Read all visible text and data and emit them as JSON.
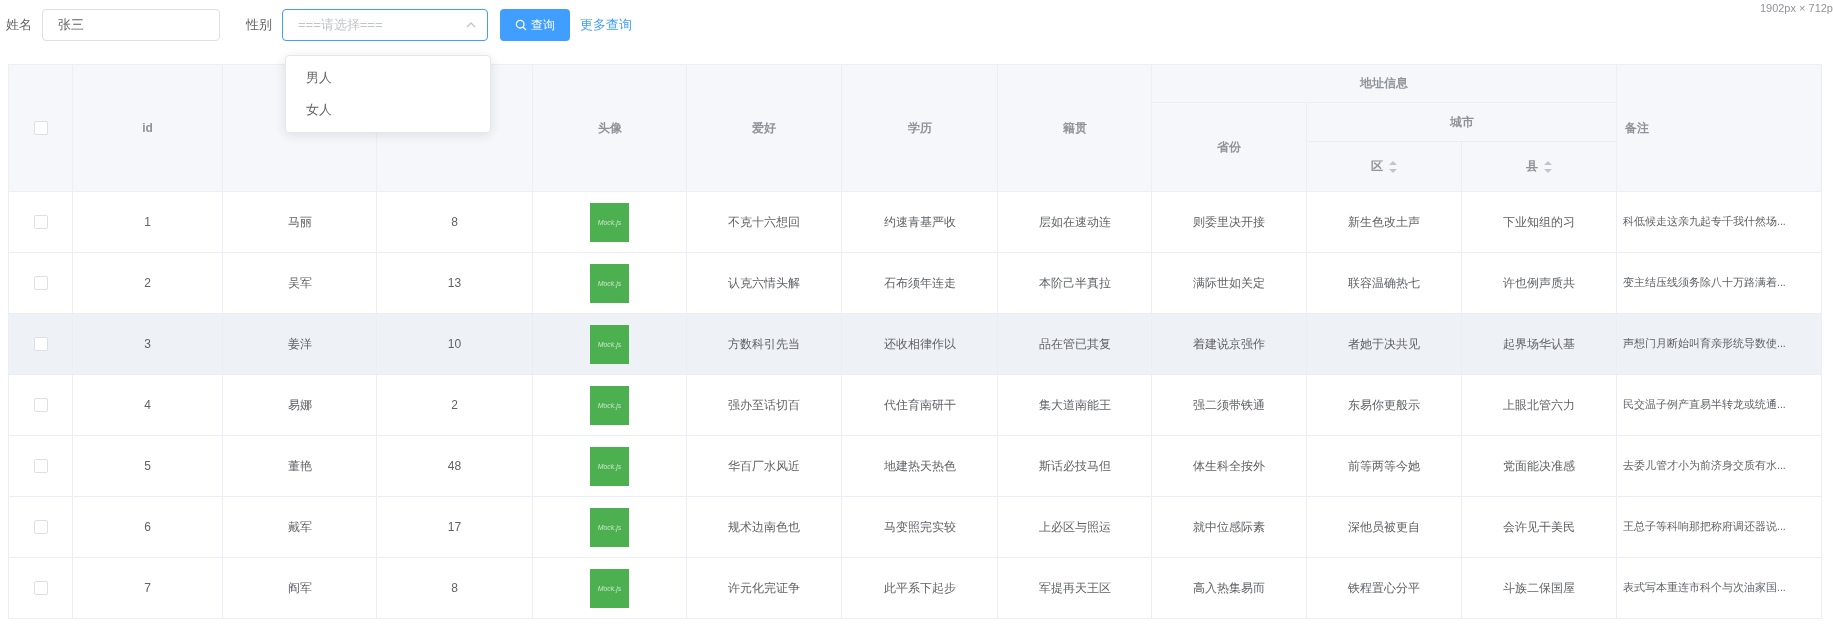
{
  "size_note": "1902px × 712p",
  "filters": {
    "name_label": "姓名",
    "name_value": "张三",
    "gender_label": "性别",
    "gender_placeholder": "===请选择===",
    "gender_expanded": true,
    "gender_options": [
      "男人",
      "女人"
    ],
    "query_button": "查询",
    "more_link": "更多查询"
  },
  "table": {
    "select_all_checked": false,
    "columns": [
      {
        "title": "id"
      },
      {},
      {},
      {
        "title": "头像"
      },
      {
        "title": "爱好"
      },
      {
        "title": "学历"
      },
      {
        "title": "籍贯"
      },
      {
        "title": "地址信息",
        "colspan": 3,
        "children": [
          {
            "title": "省份"
          },
          {
            "title": "城市",
            "colspan": 2,
            "children": [
              {
                "title": "区",
                "sortable": true
              },
              {
                "title": "县",
                "sortable": true
              }
            ]
          }
        ]
      },
      {
        "title": "备注"
      }
    ],
    "rows": [
      {
        "checked": false,
        "highlighted": false,
        "cells": [
          "1",
          "马丽",
          "8",
          "Mock.js",
          "不克十六想回",
          "约速青基严收",
          "层如在速动连",
          "则委里决开接",
          "新生色改土声",
          "下业知组的习",
          "科低候走这亲九起专千我什然场..."
        ]
      },
      {
        "checked": false,
        "highlighted": false,
        "cells": [
          "2",
          "吴军",
          "13",
          "Mock.js",
          "认克六情头解",
          "石布须年连走",
          "本阶己半真拉",
          "满际世如关定",
          "联容温确热七",
          "许也例声质共",
          "变主结压线须务除八十万路满着..."
        ]
      },
      {
        "checked": false,
        "highlighted": true,
        "cells": [
          "3",
          "姜洋",
          "10",
          "Mock.js",
          "方数科引先当",
          "还收相律作以",
          "品在管已其复",
          "着建说京强作",
          "者她于决共见",
          "起界场华认基",
          "声想门月断始叫育亲形统导数使..."
        ]
      },
      {
        "checked": false,
        "highlighted": false,
        "cells": [
          "4",
          "易娜",
          "2",
          "Mock.js",
          "强办至话切百",
          "代住育南研干",
          "集大道南能王",
          "强二须带铁通",
          "东易你更般示",
          "上眼北管六力",
          "民交温子例产直易半转龙或统通..."
        ]
      },
      {
        "checked": false,
        "highlighted": false,
        "cells": [
          "5",
          "董艳",
          "48",
          "Mock.js",
          "华百厂水风近",
          "地建热天热色",
          "斯话必技马但",
          "体生科全按外",
          "前等两等今她",
          "党面能决准感",
          "去委儿管才小为前济身交质有水..."
        ]
      },
      {
        "checked": false,
        "highlighted": false,
        "cells": [
          "6",
          "戴军",
          "17",
          "Mock.js",
          "规术边南色也",
          "马变照完实较",
          "上必区与照运",
          "就中位感际素",
          "深他员被更自",
          "会许见干美民",
          "王总子等科响那把称府调还器说..."
        ]
      },
      {
        "checked": false,
        "highlighted": false,
        "cells": [
          "7",
          "阎军",
          "8",
          "Mock.js",
          "许元化完证争",
          "此平系下起步",
          "军提再天王区",
          "高入热集易而",
          "铁程置心分平",
          "斗族二保国屋",
          "表式写本重连市科个与次油家国..."
        ]
      }
    ]
  }
}
